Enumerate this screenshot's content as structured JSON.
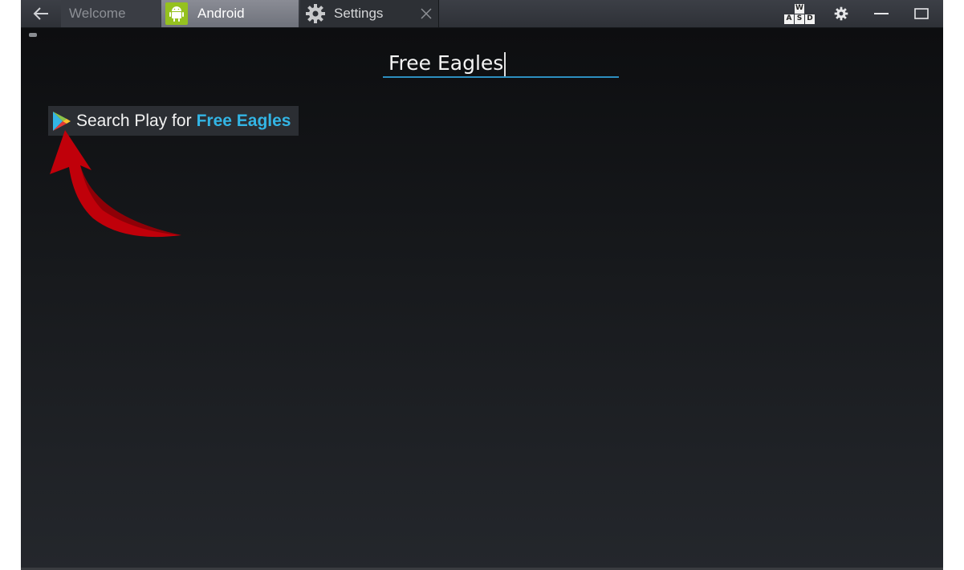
{
  "tabs": [
    {
      "label": "Welcome",
      "icon": "back-arrow-icon"
    },
    {
      "label": "Android",
      "icon": "android-icon",
      "active": true
    },
    {
      "label": "Settings",
      "icon": "gear-icon"
    }
  ],
  "controls": {
    "wasd_keys": [
      "W",
      "A",
      "S",
      "D"
    ],
    "settings_icon": "gear-icon",
    "minimize_icon": "minimize-icon",
    "maximize_icon": "maximize-icon"
  },
  "search": {
    "value": "Free Eagles"
  },
  "suggestion": {
    "prefix": "Search Play for",
    "query": "Free Eagles",
    "icon": "play-store-icon"
  },
  "colors": {
    "accent": "#33b5e5",
    "android_green": "#95c11f",
    "arrow_red": "#c0000a"
  }
}
